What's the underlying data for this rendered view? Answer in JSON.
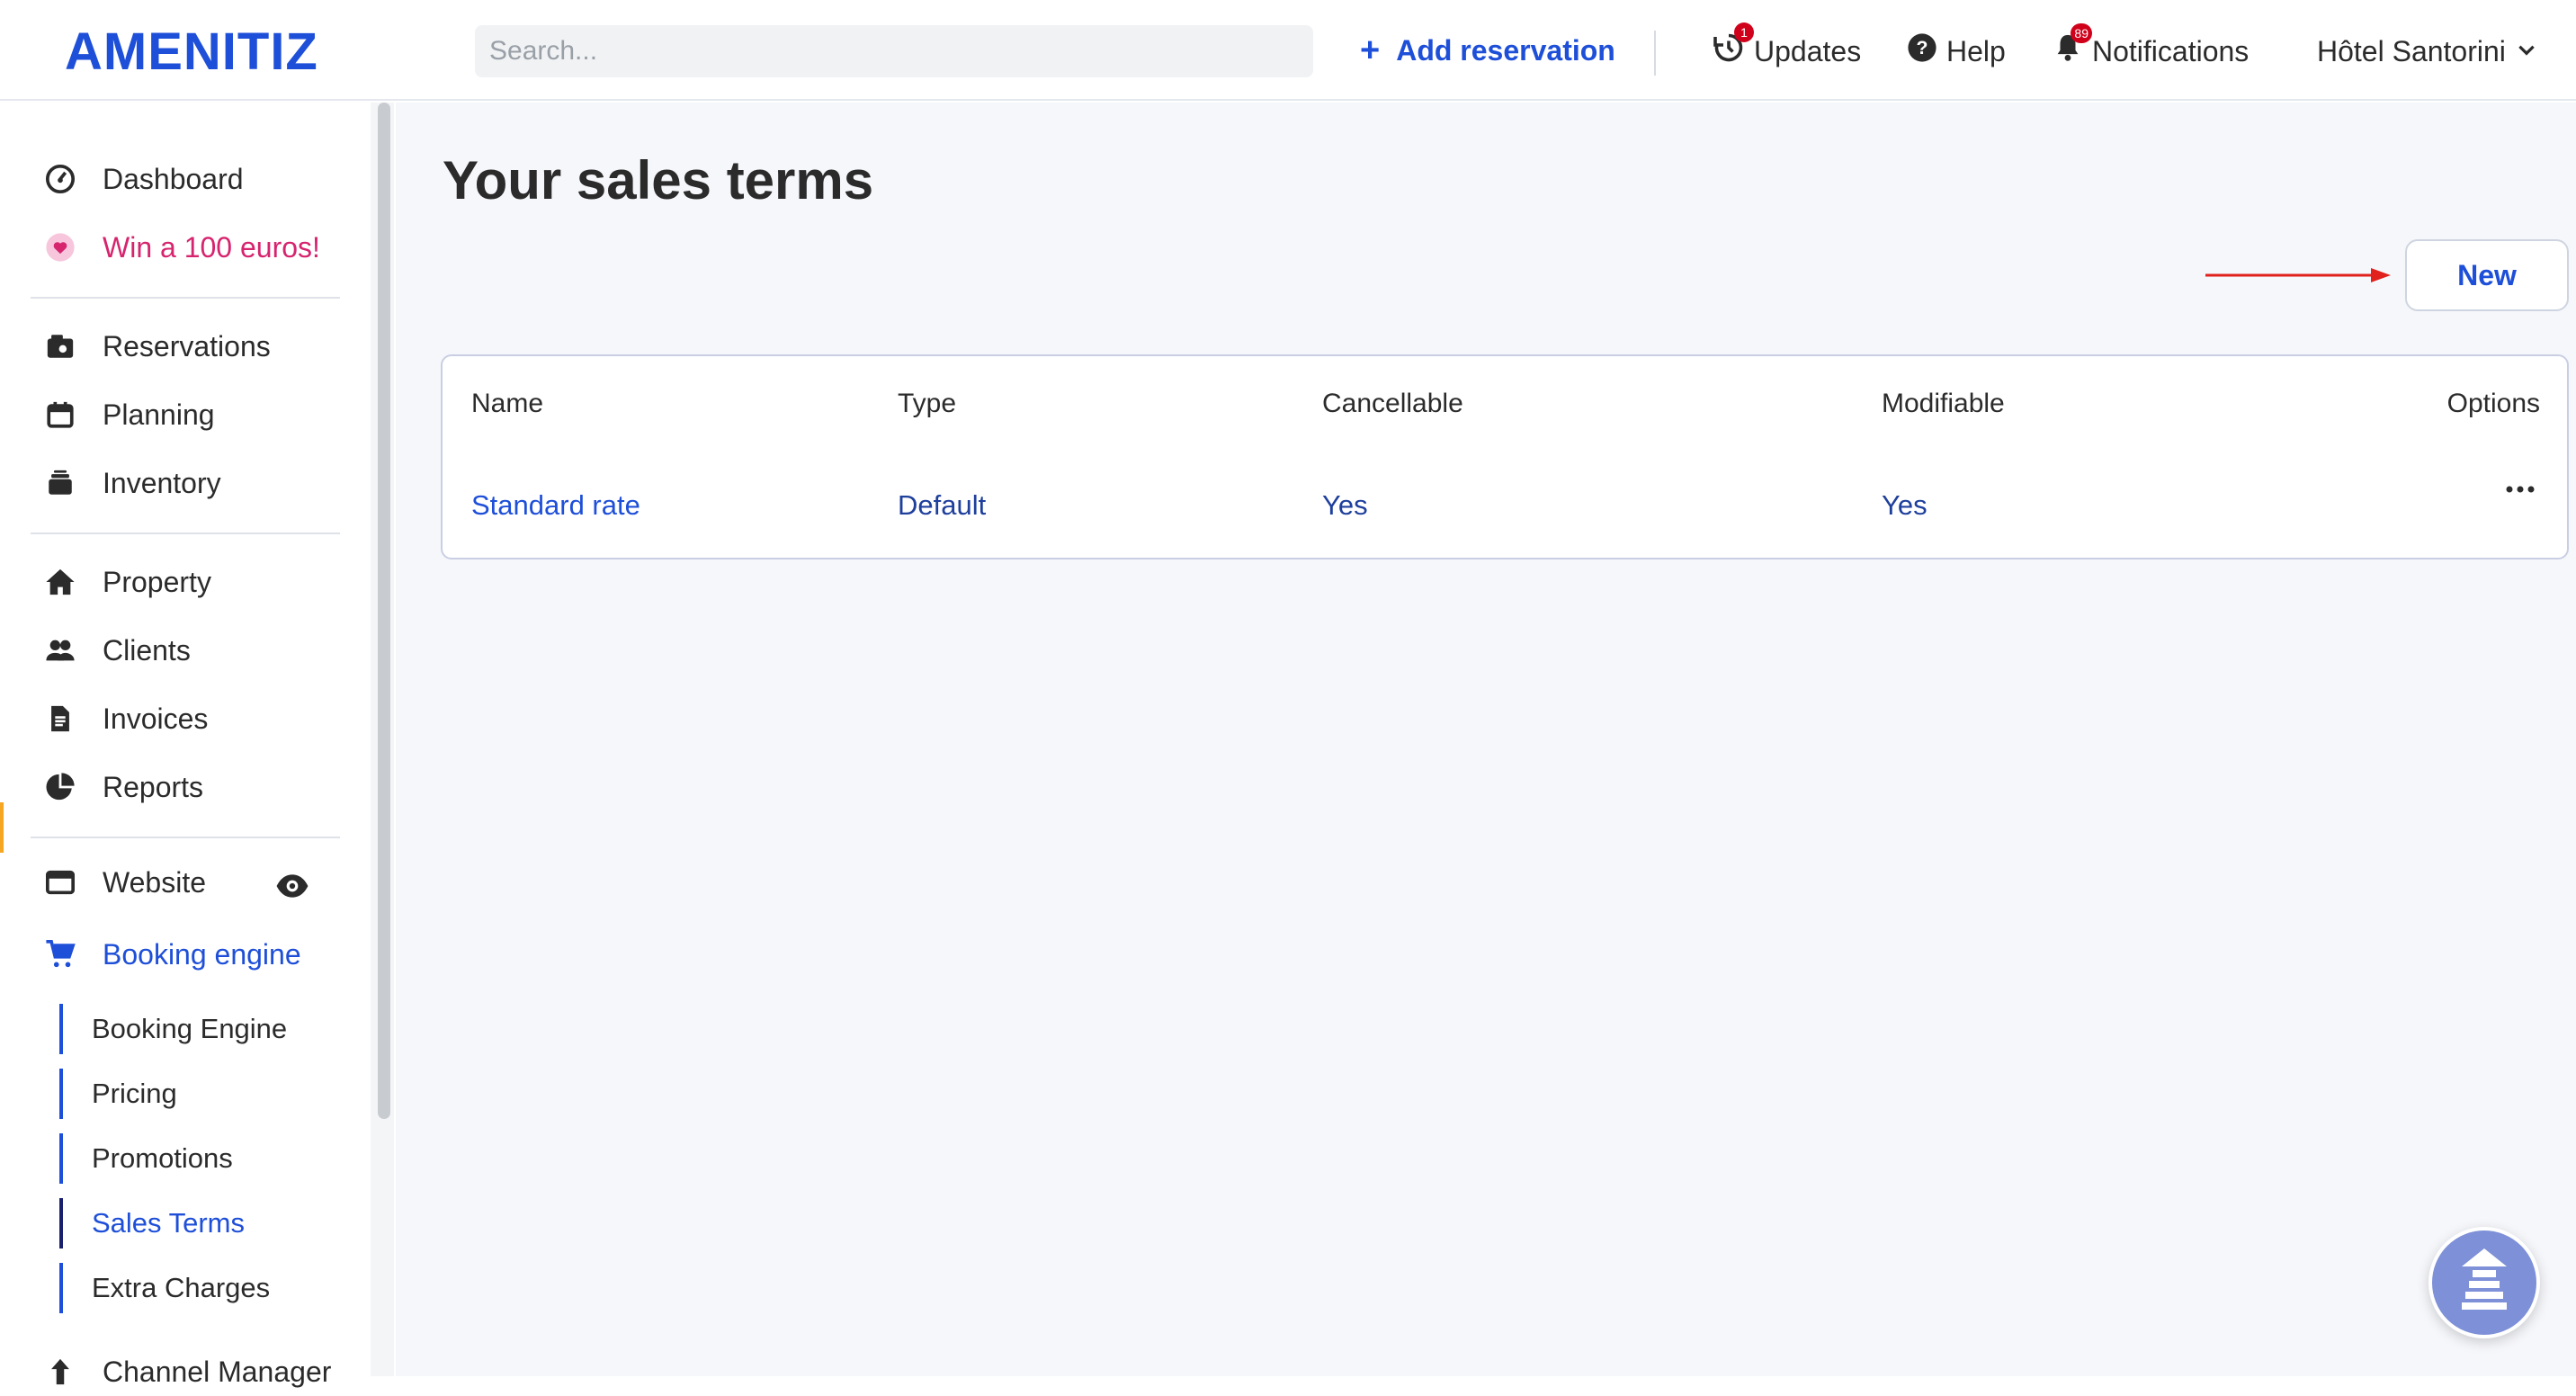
{
  "topbar": {
    "logo": "AMENITIZ",
    "search_placeholder": "Search...",
    "add_reservation": "Add reservation",
    "updates": {
      "label": "Updates",
      "badge": "1"
    },
    "help": {
      "label": "Help"
    },
    "notifications": {
      "label": "Notifications",
      "badge": "89"
    },
    "property_selector": {
      "label": "Hôtel Santorini"
    }
  },
  "sidebar": {
    "items": [
      {
        "label": "Dashboard",
        "icon": "gauge-icon"
      },
      {
        "label": "Win a 100 euros!",
        "icon": "heart-icon"
      },
      {
        "label": "Reservations",
        "icon": "reservations-icon"
      },
      {
        "label": "Planning",
        "icon": "calendar-icon"
      },
      {
        "label": "Inventory",
        "icon": "inventory-icon"
      },
      {
        "label": "Property",
        "icon": "home-icon"
      },
      {
        "label": "Clients",
        "icon": "users-icon"
      },
      {
        "label": "Invoices",
        "icon": "invoice-icon"
      },
      {
        "label": "Reports",
        "icon": "pie-chart-icon"
      },
      {
        "label": "Website",
        "icon": "browser-window-icon"
      },
      {
        "label": "Booking engine",
        "icon": "cart-icon"
      },
      {
        "label": "Channel Manager",
        "icon": "upload-arrow-icon"
      }
    ],
    "sub_items": [
      {
        "label": "Booking Engine"
      },
      {
        "label": "Pricing"
      },
      {
        "label": "Promotions"
      },
      {
        "label": "Sales Terms"
      },
      {
        "label": "Extra Charges"
      }
    ]
  },
  "main": {
    "title": "Your sales terms",
    "new_button": "New",
    "table": {
      "headers": [
        "Name",
        "Type",
        "Cancellable",
        "Modifiable",
        "Options"
      ],
      "rows": [
        {
          "name": "Standard rate",
          "type": "Default",
          "cancellable": "Yes",
          "modifiable": "Yes"
        }
      ]
    }
  },
  "colors": {
    "accent": "#1e4fd8",
    "pink": "#d6246e",
    "background": "#f6f7fb",
    "annotation_arrow": "#e0211c"
  }
}
